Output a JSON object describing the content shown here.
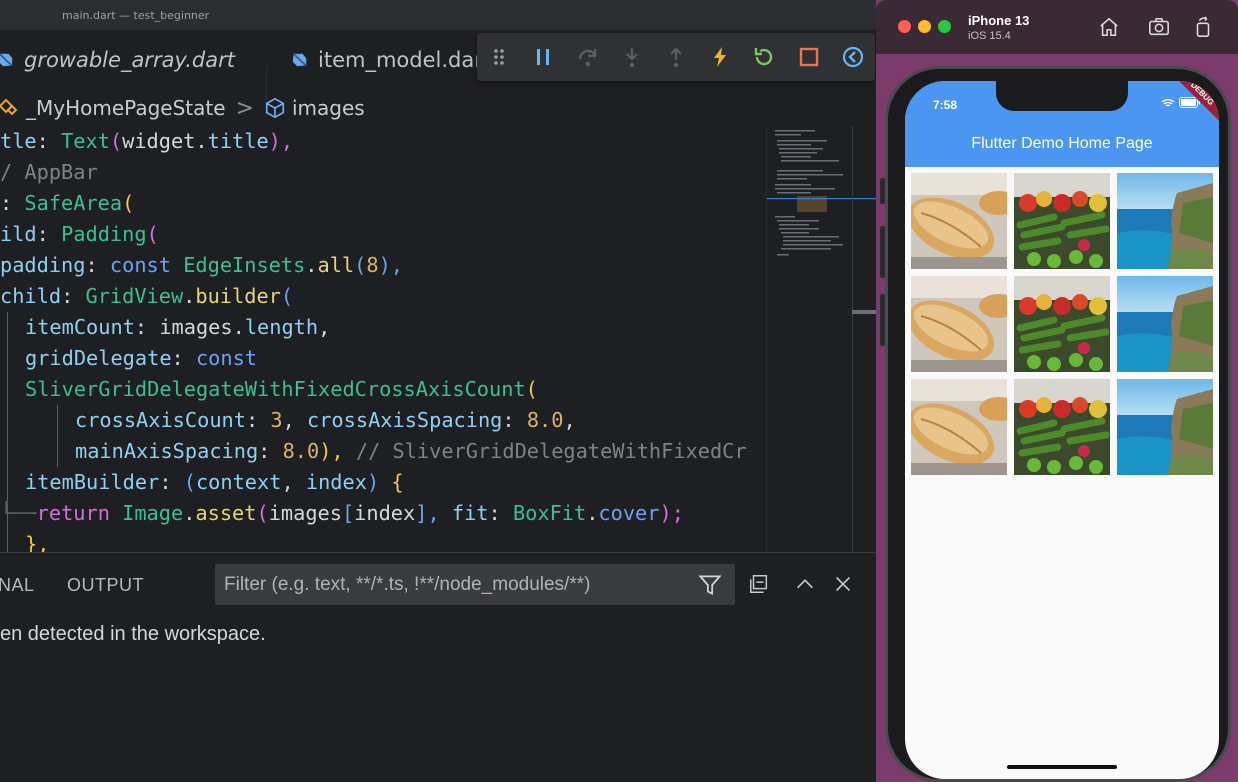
{
  "window": {
    "title": "main.dart — test_beginner"
  },
  "tabs": [
    {
      "label": "growable_array.dart",
      "icon": "dart-file-icon"
    },
    {
      "label": "item_model.dart",
      "icon": "dart-file-icon"
    }
  ],
  "debug_toolbar": {
    "buttons": [
      "drag-handle-icon",
      "pause-icon",
      "step-over-icon",
      "step-into-icon",
      "step-out-icon",
      "hot-reload-icon",
      "hot-restart-icon",
      "stop-icon",
      "devtools-icon"
    ]
  },
  "breadcrumb": {
    "item1": "_MyHomePageState",
    "separator": ">",
    "item2": "images"
  },
  "code": {
    "l1": {
      "a": "tle",
      "b": ": ",
      "c": "Text",
      "d": "(",
      "e": "widget",
      "f": ".",
      "g": "title",
      "h": "),"
    },
    "l2": "/ AppBar",
    "l3": {
      "a": ": ",
      "b": "SafeArea",
      "c": "("
    },
    "l4": {
      "a": "ild",
      "b": ": ",
      "c": "Padding",
      "d": "("
    },
    "l5": {
      "a": "padding",
      "b": ": ",
      "c": "const",
      "d": " ",
      "e": "EdgeInsets",
      "f": ".",
      "g": "all",
      "h": "(",
      "i": "8",
      "j": "),"
    },
    "l6": {
      "a": "child",
      "b": ": ",
      "c": "GridView",
      "d": ".",
      "e": "builder",
      "f": "("
    },
    "l7": {
      "a": "itemCount",
      "b": ": ",
      "c": "images",
      "d": ".",
      "e": "length",
      "f": ","
    },
    "l8": {
      "a": "gridDelegate",
      "b": ": ",
      "c": "const"
    },
    "l9": {
      "a": "SliverGridDelegateWithFixedCrossAxisCount",
      "b": "("
    },
    "l10": {
      "a": "crossAxisCount",
      "b": ": ",
      "c": "3",
      "d": ", ",
      "e": "crossAxisSpacing",
      "f": ": ",
      "g": "8.0",
      "h": ","
    },
    "l11": {
      "a": "mainAxisSpacing",
      "b": ": ",
      "c": "8.0",
      "d": "), ",
      "e": "// SliverGridDelegateWithFixedCr"
    },
    "l12": {
      "a": "itemBuilder",
      "b": ": ",
      "c": "(",
      "d": "context",
      "e": ", ",
      "f": "index",
      "g": ") ",
      "h": "{"
    },
    "l13": {
      "a": "return",
      "b": " ",
      "c": "Image",
      "d": ".",
      "e": "asset",
      "f": "(",
      "g": "images",
      "h": "[",
      "i": "index",
      "j": "], ",
      "k": "fit",
      "l": ": ",
      "m": "BoxFit",
      "n": ".",
      "o": "cover",
      "p": ");"
    },
    "l14": "},"
  },
  "panel": {
    "tab_terminal": "NAL",
    "tab_output": "OUTPUT",
    "filter_placeholder": "Filter (e.g. text, **/*.ts, !**/node_modules/**)",
    "message": "en detected in the workspace."
  },
  "simulator": {
    "device": "iPhone 13",
    "os": "iOS 15.4",
    "status_time": "7:58",
    "debug_banner": "DEBUG",
    "app_title": "Flutter Demo Home Page",
    "grid_images": [
      "bread",
      "vegetables",
      "coast",
      "bread",
      "vegetables",
      "coast",
      "bread",
      "vegetables",
      "coast"
    ]
  },
  "colors": {
    "keyword": "#6da2f2",
    "type": "#3fbf8f",
    "function": "#e6d47a",
    "property": "#8fd0f2",
    "paren": "#f2c94c",
    "comment": "#7e828a",
    "number": "#d9b36a",
    "appbar": "#4a96f0"
  }
}
